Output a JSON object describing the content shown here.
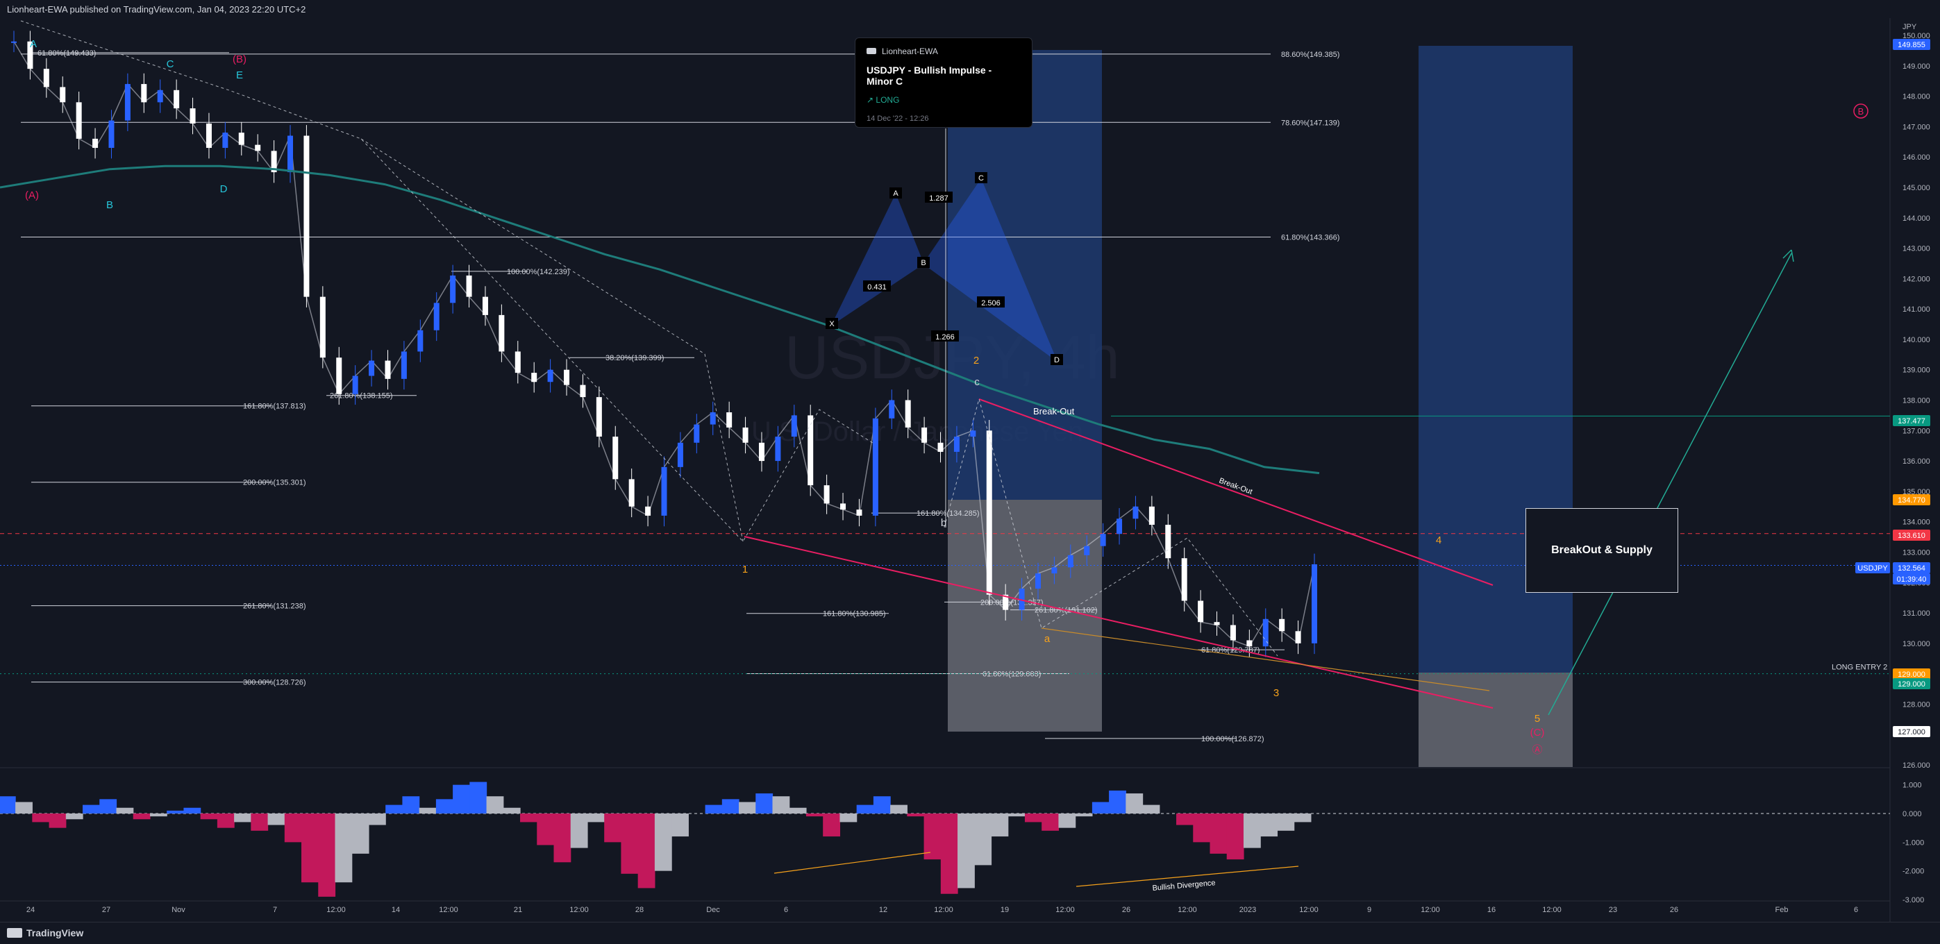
{
  "header": {
    "publisher": "Lionheart-EWA published on TradingView.com, Jan 04, 2023 22:20 UTC+2"
  },
  "footer": {
    "brand": "TradingView"
  },
  "idea_card": {
    "author": "Lionheart-EWA",
    "title": "USDJPY - Bullish Impulse - Minor C",
    "position": "↗ LONG",
    "date": "14 Dec '22 - 12:26"
  },
  "supply_box": {
    "label": "BreakOut & Supply"
  },
  "watermark": {
    "symbol": "USDJPY, 4h",
    "name": "U.S. Dollar / Japanese Yen"
  },
  "colors": {
    "background": "#131722",
    "up": "#2962ff",
    "down": "#ffffff",
    "ma": "#1e7c7a",
    "trendline": "#e91e63",
    "target_zone": "#1e3a6e",
    "stop_zone": "#5d606b",
    "wave_orange": "#f7a21b",
    "wave_pink": "#e91e63",
    "wave_cyan": "#26c6da"
  },
  "chart_data": {
    "type": "line",
    "title": "",
    "symbol": "USDJPY",
    "unit": "JPY",
    "ylim": [
      126.0,
      150.5
    ],
    "price_axis_ticks": [
      "150.000",
      "149.000",
      "148.000",
      "147.000",
      "146.000",
      "145.000",
      "144.000",
      "143.000",
      "142.000",
      "141.000",
      "140.000",
      "139.000",
      "138.000",
      "137.000",
      "136.000",
      "135.000",
      "134.000",
      "133.000",
      "132.000",
      "131.000",
      "130.000",
      "129.000",
      "128.000",
      "127.000",
      "126.000"
    ],
    "price_badges": [
      {
        "value": "149.855",
        "color": "#2962ff"
      },
      {
        "value": "137.477",
        "color": "#089981"
      },
      {
        "value": "134.770",
        "color": "#ff9800"
      },
      {
        "value": "133.610",
        "color": "#f23645"
      },
      {
        "value": "132.564",
        "color": "#2962ff",
        "label": "USDJPY",
        "countdown": "01:39:40"
      },
      {
        "value": "129.000",
        "color": "#ff9800"
      },
      {
        "value": "129.000",
        "color": "#089981"
      },
      {
        "value": "127.000",
        "color": "#ffffff"
      }
    ],
    "time_axis_labels": [
      "24",
      "27",
      "Nov",
      "7",
      "12:00",
      "14",
      "12:00",
      "21",
      "12:00",
      "28",
      "Dec",
      "6",
      "12",
      "12:00",
      "19",
      "12:00",
      "26",
      "12:00",
      "2023",
      "12:00",
      "9",
      "12:00",
      "16",
      "12:00",
      "23",
      "26",
      "Feb",
      "6"
    ],
    "series": [
      {
        "name": "USDJPY 4h (approx. close)",
        "values": [
          149.8,
          148.9,
          148.3,
          147.8,
          146.6,
          146.3,
          147.2,
          148.4,
          147.8,
          148.2,
          147.6,
          147.1,
          146.3,
          146.8,
          146.4,
          146.2,
          145.5,
          146.7,
          141.4,
          139.4,
          138.2,
          138.8,
          139.3,
          138.7,
          139.6,
          140.3,
          141.2,
          142.1,
          141.4,
          140.8,
          139.6,
          138.9,
          138.6,
          139.0,
          138.5,
          138.1,
          136.8,
          135.4,
          134.5,
          134.2,
          135.8,
          136.6,
          137.2,
          137.6,
          137.1,
          136.6,
          136.0,
          136.8,
          137.5,
          135.2,
          134.6,
          134.4,
          134.2,
          137.4,
          138.0,
          137.1,
          136.6,
          136.3,
          136.8,
          137.0,
          131.6,
          131.1,
          131.8,
          132.3,
          132.5,
          132.9,
          133.2,
          133.6,
          134.1,
          134.5,
          133.9,
          132.8,
          131.4,
          130.7,
          130.6,
          130.1,
          129.9,
          130.8,
          130.4,
          130.0,
          132.6
        ]
      },
      {
        "name": "Moving average",
        "values": [
          145.0,
          145.3,
          145.6,
          145.7,
          145.7,
          145.6,
          145.4,
          145.1,
          144.6,
          144.0,
          143.4,
          142.8,
          142.3,
          141.7,
          141.1,
          140.5,
          139.8,
          139.1,
          138.4,
          137.8,
          137.2,
          136.7,
          136.4,
          135.8,
          135.6
        ]
      }
    ],
    "horizontal_levels": [
      {
        "label": "88.60%(149.385)",
        "value": 149.385
      },
      {
        "label": "78.60%(147.139)",
        "value": 147.139
      },
      {
        "label": "61.80%(143.366)",
        "value": 143.366
      },
      {
        "label": "61.80%(149.433)",
        "value": 149.433
      },
      {
        "label": "100.00%(142.239)",
        "value": 142.239
      },
      {
        "label": "38.20%(139.399)",
        "value": 139.399
      },
      {
        "label": "261.80%(138.155)",
        "value": 138.155
      },
      {
        "label": "161.80%(137.813)",
        "value": 137.813
      },
      {
        "label": "200.00%(135.301)",
        "value": 135.301
      },
      {
        "label": "161.80%(134.285)",
        "value": 134.285
      },
      {
        "label": "261.80%(131.238)",
        "value": 131.238
      },
      {
        "label": "200.00%(131.357)",
        "value": 131.357
      },
      {
        "label": "261.80%(131.102)",
        "value": 131.102
      },
      {
        "label": "161.80%(130.985)",
        "value": 130.985
      },
      {
        "label": "61.80%(129.787)",
        "value": 129.787
      },
      {
        "label": "61.80%(129.003)",
        "value": 129.003
      },
      {
        "label": "300.00%(128.726)",
        "value": 128.726
      },
      {
        "label": "100.00%(126.872)",
        "value": 126.872
      }
    ],
    "harmonic_pattern": {
      "points": [
        "X",
        "A",
        "B",
        "C",
        "D"
      ],
      "ratios": [
        "0.431",
        "1.287",
        "2.506",
        "1.266"
      ]
    },
    "wave_labels": [
      "A",
      "B",
      "C",
      "D",
      "E",
      "(A)",
      "(B)",
      "(C)",
      "Ⓐ",
      "a",
      "b",
      "c",
      "1",
      "2",
      "3",
      "4",
      "5"
    ],
    "annotations": [
      "Break-Out",
      "Break-Out",
      "LONG ENTRY 2",
      "Bullish Divergence",
      "BreakOut & Supply"
    ],
    "oscillator": {
      "ticks": [
        "1.000",
        "0.000",
        "-1.000",
        "-2.000",
        "-3.000"
      ],
      "ylim": [
        -3.0,
        1.5
      ],
      "values": [
        0.6,
        0.4,
        -0.3,
        -0.5,
        -0.2,
        0.3,
        0.5,
        0.2,
        -0.2,
        -0.1,
        0.1,
        0.2,
        -0.2,
        -0.5,
        -0.3,
        -0.6,
        -0.4,
        -1.0,
        -2.4,
        -2.9,
        -2.4,
        -1.4,
        -0.4,
        0.3,
        0.6,
        0.2,
        0.5,
        1.0,
        1.1,
        0.6,
        0.2,
        -0.3,
        -1.1,
        -1.7,
        -1.2,
        -0.3,
        -1.0,
        -2.1,
        -2.6,
        -2.0,
        -0.8,
        0.0,
        0.3,
        0.5,
        0.4,
        0.7,
        0.6,
        0.2,
        -0.1,
        -0.8,
        -0.3,
        0.3,
        0.6,
        0.3,
        -0.1,
        -1.6,
        -2.8,
        -2.6,
        -1.8,
        -0.8,
        -0.1,
        -0.3,
        -0.6,
        -0.5,
        -0.1,
        0.4,
        0.8,
        0.7,
        0.3,
        0.0,
        -0.4,
        -1.0,
        -1.4,
        -1.6,
        -1.2,
        -0.8,
        -0.6,
        -0.3,
        0.0
      ]
    }
  }
}
